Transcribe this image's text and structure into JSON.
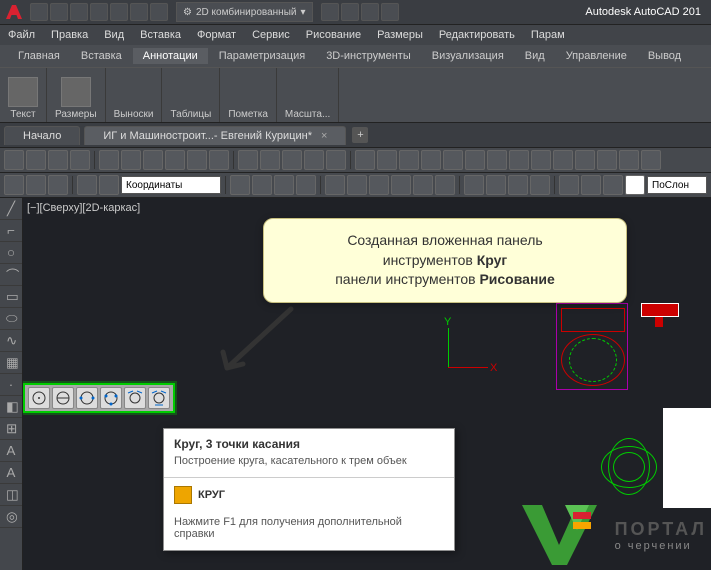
{
  "app": {
    "title": "Autodesk AutoCAD 201"
  },
  "workspace_selector": "2D комбинированный",
  "menubar": [
    "Файл",
    "Правка",
    "Вид",
    "Вставка",
    "Формат",
    "Сервис",
    "Рисование",
    "Размеры",
    "Редактировать",
    "Парам"
  ],
  "ribbon_tabs": [
    "Главная",
    "Вставка",
    "Аннотации",
    "Параметризация",
    "3D-инструменты",
    "Визуализация",
    "Вид",
    "Управление",
    "Вывод"
  ],
  "ribbon_active": "Аннотации",
  "ribbon_panels": [
    {
      "label": "Текст"
    },
    {
      "label": "Размеры"
    },
    {
      "label": "Выноски"
    },
    {
      "label": "Таблицы"
    },
    {
      "label": "Пометка"
    },
    {
      "label": "Масшта..."
    }
  ],
  "doc_tabs": [
    {
      "label": "Начало"
    },
    {
      "label": "ИГ и Машиностроит...- Евгений Курицин*",
      "active": true
    }
  ],
  "coords_label": "Координаты",
  "layer_label": "ПоСлон",
  "viewport_label": "[−][Сверху][2D-каркас]",
  "ucs": {
    "x": "X",
    "y": "Y"
  },
  "callout": {
    "line1": "Созданная вложенная панель",
    "line2a": "инструментов ",
    "line2b": "Круг",
    "line3a": "панели инструментов ",
    "line3b": "Рисование"
  },
  "circle_flyout_icons": [
    "circle-center-radius",
    "circle-center-diameter",
    "circle-2-points",
    "circle-3-points",
    "circle-tan-tan-radius",
    "circle-tan-tan-tan"
  ],
  "tooltip": {
    "title": "Круг, 3 точки касания",
    "desc": "Построение круга, касательного к трем объек",
    "command": "КРУГ",
    "help": "Нажмите F1 для получения дополнительной справки"
  },
  "portal": {
    "line1": "ПОРТАЛ",
    "line2": "о черчении"
  }
}
